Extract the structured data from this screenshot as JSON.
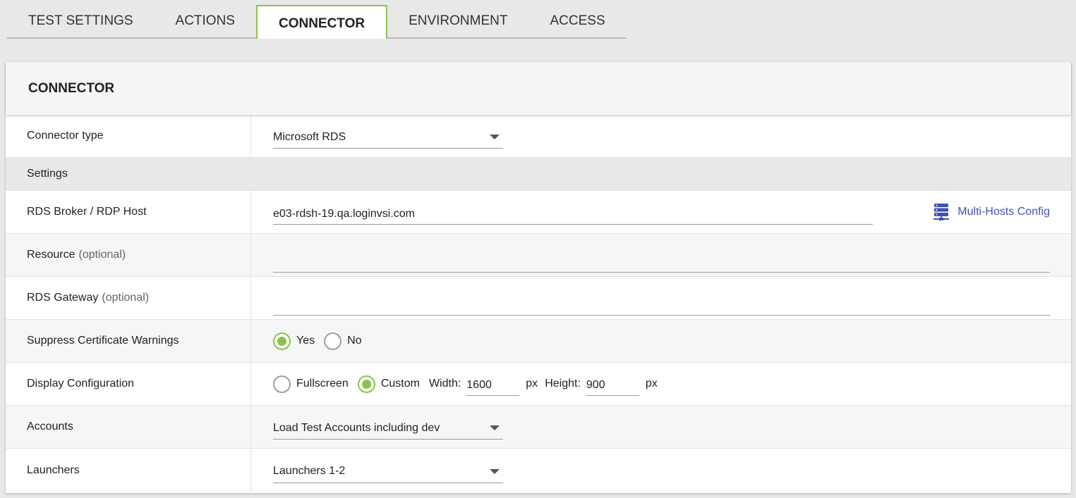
{
  "tabs": [
    {
      "label": "TEST SETTINGS"
    },
    {
      "label": "ACTIONS"
    },
    {
      "label": "CONNECTOR"
    },
    {
      "label": "ENVIRONMENT"
    },
    {
      "label": "ACCESS"
    }
  ],
  "panel": {
    "title": "CONNECTOR"
  },
  "connector_type": {
    "label": "Connector type",
    "value": "Microsoft RDS"
  },
  "settings_section": "Settings",
  "rds_broker": {
    "label": "RDS Broker / RDP Host",
    "value": "e03-rdsh-19.qa.loginvsi.com",
    "link": "Multi-Hosts Config"
  },
  "resource": {
    "label": "Resource",
    "optional": "(optional)",
    "value": ""
  },
  "rds_gateway": {
    "label": "RDS Gateway",
    "optional": "(optional)",
    "value": ""
  },
  "suppress_cert": {
    "label": "Suppress Certificate Warnings",
    "yes": "Yes",
    "no": "No",
    "selected": "Yes"
  },
  "display_config": {
    "label": "Display Configuration",
    "fullscreen": "Fullscreen",
    "custom": "Custom",
    "selected": "Custom",
    "width_label": "Width:",
    "width": "1600",
    "height_label": "Height:",
    "height": "900",
    "unit": "px"
  },
  "accounts": {
    "label": "Accounts",
    "value": "Load Test Accounts including dev"
  },
  "launchers": {
    "label": "Launchers",
    "value": "Launchers 1-2"
  },
  "colors": {
    "accent": "#8bc34a",
    "link": "#3f51b5"
  }
}
